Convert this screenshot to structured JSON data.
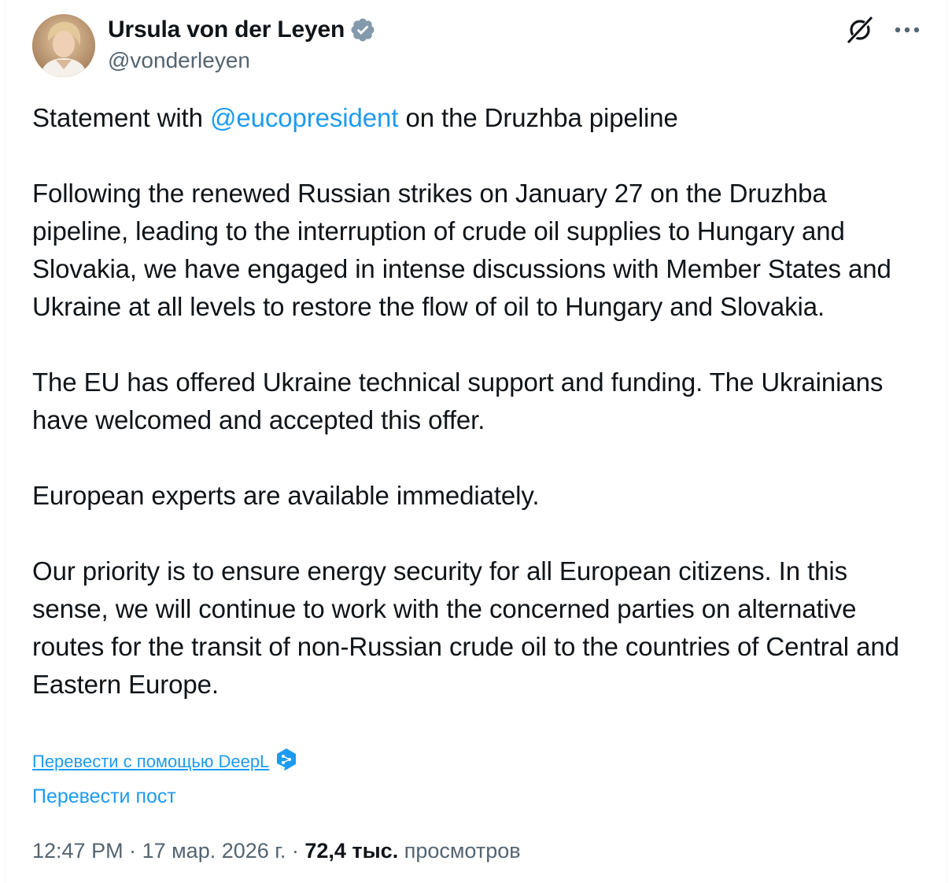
{
  "author": {
    "display_name": "Ursula von der Leyen",
    "handle": "@vonderleyen",
    "verified": true,
    "verified_color": "#829aab"
  },
  "icons": {
    "grok": "grok-icon",
    "more": "more-options-icon",
    "verified": "verified-badge-icon",
    "deepl": "deepl-icon"
  },
  "post": {
    "line1_before": "Statement with ",
    "line1_mention": "@eucopresident",
    "line1_after": " on the Druzhba pipeline",
    "paragraph2": "Following the renewed Russian strikes on January 27 on the Druzhba pipeline, leading to the interruption of crude oil supplies to Hungary and Slovakia, we have engaged in intense discussions with Member States and Ukraine at all levels to restore the flow of oil to Hungary and Slovakia.",
    "paragraph3": "The EU has offered Ukraine technical support and funding. The Ukrainians have welcomed and accepted this offer.",
    "paragraph4": "European experts are available immediately.",
    "paragraph5": "Our priority is to ensure energy security for all European citizens. In this sense, we will continue to work with the concerned parties on alternative routes for the transit of non-Russian crude oil to the countries of Central and Eastern Europe."
  },
  "translate": {
    "deepl_label": "Перевести с помощью DeepL",
    "translate_post_label": "Перевести пост"
  },
  "meta": {
    "time": "12:47 PM",
    "sep1": " · ",
    "date": "17 мар. 2026 г.",
    "sep2": " · ",
    "views_count": "72,4 тыс.",
    "views_label": " просмотров"
  },
  "colors": {
    "link": "#1d9bf0",
    "text": "#0f1419",
    "secondary": "#536471",
    "deepl": "#0f2b46"
  }
}
